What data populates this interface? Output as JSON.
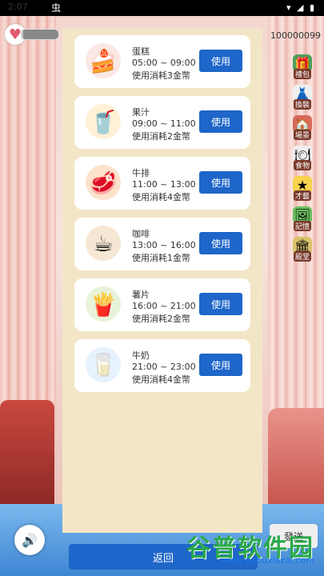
{
  "status_bar": {
    "time": "2:07",
    "debug_icon": "虫",
    "right_icons": "▾ ◢ ▮"
  },
  "header": {
    "heart_progress": 0.05,
    "coin_count": "100000099"
  },
  "right_menu": [
    {
      "label": "禮包",
      "icon": "gift-icon"
    },
    {
      "label": "換裝",
      "icon": "dress-icon"
    },
    {
      "label": "場景",
      "icon": "house-icon"
    },
    {
      "label": "食物",
      "icon": "food-icon"
    },
    {
      "label": "才藝",
      "icon": "star-icon"
    },
    {
      "label": "記憶",
      "icon": "memory-icon"
    },
    {
      "label": "殿堂",
      "icon": "hall-icon"
    }
  ],
  "items": [
    {
      "name": "蛋糕",
      "time": "05:00 ~ 09:00",
      "cost": "使用消耗3金幣",
      "button": "使用",
      "icon": "cake-icon"
    },
    {
      "name": "果汁",
      "time": "09:00 ~ 11:00",
      "cost": "使用消耗2金幣",
      "button": "使用",
      "icon": "juice-icon"
    },
    {
      "name": "牛排",
      "time": "11:00 ~ 13:00",
      "cost": "使用消耗4金幣",
      "button": "使用",
      "icon": "steak-icon"
    },
    {
      "name": "咖啡",
      "time": "13:00 ~ 16:00",
      "cost": "使用消耗1金幣",
      "button": "使用",
      "icon": "coffee-icon"
    },
    {
      "name": "薯片",
      "time": "16:00 ~ 21:00",
      "cost": "使用消耗2金幣",
      "button": "使用",
      "icon": "chips-icon"
    },
    {
      "name": "牛奶",
      "time": "21:00 ~ 23:00",
      "cost": "使用消耗4金幣",
      "button": "使用",
      "icon": "milk-icon"
    }
  ],
  "footer": {
    "back_label": "返回",
    "send_label": "發送"
  },
  "watermark": {
    "title": "谷普软件园",
    "url": "www.gupuxiazai.com"
  }
}
